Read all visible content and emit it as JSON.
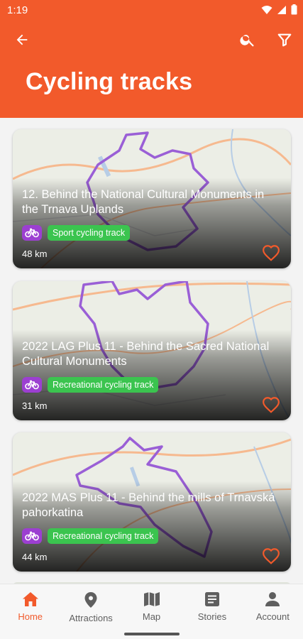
{
  "status_bar": {
    "time": "1:19"
  },
  "colors": {
    "primary": "#f25a2b",
    "bike_badge": "#9c3fd1",
    "chip": "#3bc44f",
    "route": "#a06ad8"
  },
  "toolbar": {
    "back_icon": "arrow-back-icon",
    "search_icon": "search-icon",
    "filter_icon": "filter-icon"
  },
  "page": {
    "title": "Cycling tracks"
  },
  "tracks": [
    {
      "title": "12. Behind the National Cultural Monuments in the Trnava Uplands",
      "type": "Sport cycling track",
      "distance": "48 km"
    },
    {
      "title": "2022 LAG Plus 11 - Behind the Sacred National Cultural Monuments",
      "type": "Recreational cycling track",
      "distance": "31 km"
    },
    {
      "title": "2022 MAS Plus 11 - Behind the mills of Trnavská pahorkatina",
      "type": "Recreational cycling track",
      "distance": "44 km"
    }
  ],
  "bottom_nav": [
    {
      "label": "Home",
      "icon": "home-icon",
      "active": true
    },
    {
      "label": "Attractions",
      "icon": "place-icon",
      "active": false
    },
    {
      "label": "Map",
      "icon": "map-icon",
      "active": false
    },
    {
      "label": "Stories",
      "icon": "article-icon",
      "active": false
    },
    {
      "label": "Account",
      "icon": "account-icon",
      "active": false
    }
  ]
}
